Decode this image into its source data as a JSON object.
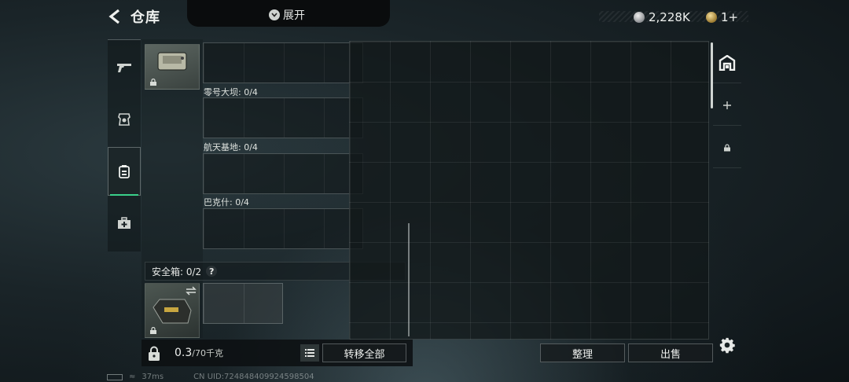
{
  "header": {
    "title": "仓库",
    "expand_label": "展开",
    "currencies": [
      {
        "icon": "silver-coin-icon",
        "value": "2,228K"
      },
      {
        "icon": "gold-coin-icon",
        "value": "1+"
      }
    ]
  },
  "nav": {
    "items": [
      {
        "icon": "gun-icon",
        "active": false
      },
      {
        "icon": "armor-icon",
        "active": false
      },
      {
        "icon": "backpack-icon",
        "active": true
      },
      {
        "icon": "medkit-icon",
        "active": false
      }
    ]
  },
  "containers": [
    {
      "label": ""
    },
    {
      "label": "零号大坝: 0/4"
    },
    {
      "label": "航天基地: 0/4"
    },
    {
      "label": "巴克什: 0/4"
    }
  ],
  "safe_box": {
    "label": "安全箱: 0/2",
    "help": "?"
  },
  "bottom": {
    "weight_value": "0.3",
    "weight_max": "/70千克",
    "transfer_all": "转移全部",
    "sort": "整理",
    "sell": "出售"
  },
  "footer": {
    "ping": "37ms",
    "uid": "CN UID:724848409924598504"
  },
  "colors": {
    "active_accent": "#3ad08a"
  }
}
